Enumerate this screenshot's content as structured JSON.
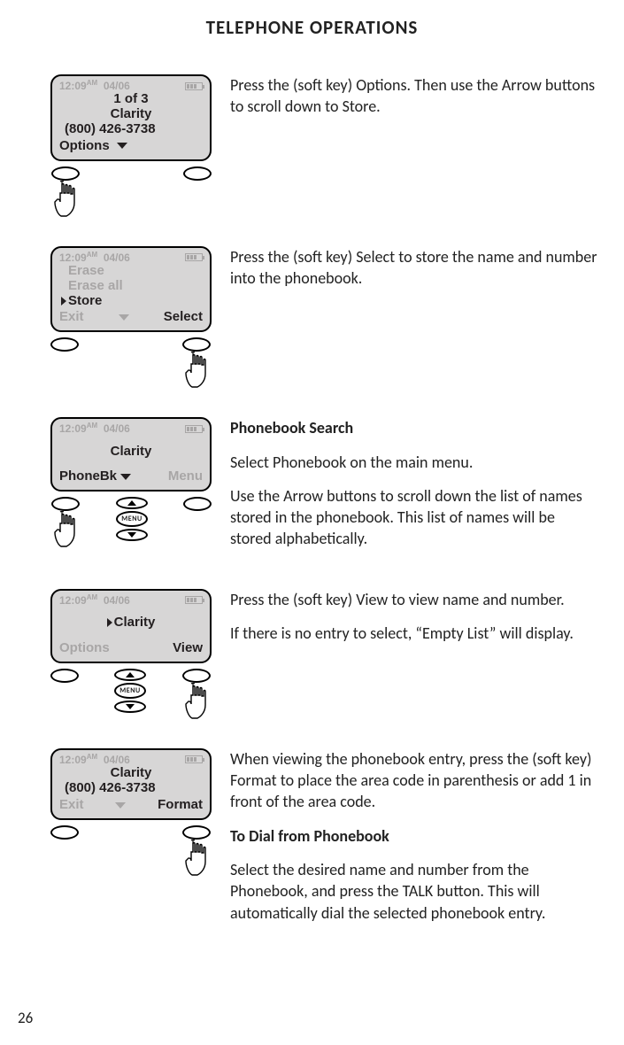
{
  "page_title": "TELEPHONE OPERATIONS",
  "page_number": "26",
  "common": {
    "time": "12:09",
    "ampm": "AM",
    "date": "04/06",
    "menu_label": "MENU"
  },
  "step1": {
    "line1": "1 of 3",
    "line2": "Clarity",
    "line3": "(800) 426-3738",
    "soft_left": "Options",
    "text": "Press the (soft key) Options. Then use the Arrow buttons to scroll down to Store."
  },
  "step2": {
    "item1": "Erase",
    "item2": "Erase all",
    "item3": "Store",
    "soft_left": "Exit",
    "soft_right": "Select",
    "text": "Press the (soft key) Select to store the name and number into the phonebook."
  },
  "step3": {
    "heading": "Phonebook Search",
    "line1": "Clarity",
    "soft_left": "PhoneBk",
    "soft_right": "Menu",
    "text1": "Select Phonebook on the main menu.",
    "text2": "Use the Arrow buttons to scroll down the list of names stored in the phonebook. This list of names will be stored alphabetically."
  },
  "step4": {
    "line1": "Clarity",
    "soft_left": "Options",
    "soft_right": "View",
    "text1": "Press the (soft key) View to view name and number.",
    "text2": "If there is no entry to select, “Empty List” will display."
  },
  "step5": {
    "line1": "Clarity",
    "line2": "(800) 426-3738",
    "soft_left": "Exit",
    "soft_right": "Format",
    "text1": "When viewing the phonebook entry, press the (soft key) Format to place the area code in parenthesis or add 1 in front of the area code.",
    "heading2": "To Dial from Phonebook",
    "text2": "Select the desired name and number from the Phonebook, and press the TALK button. This will automatically dial the selected phonebook entry."
  }
}
